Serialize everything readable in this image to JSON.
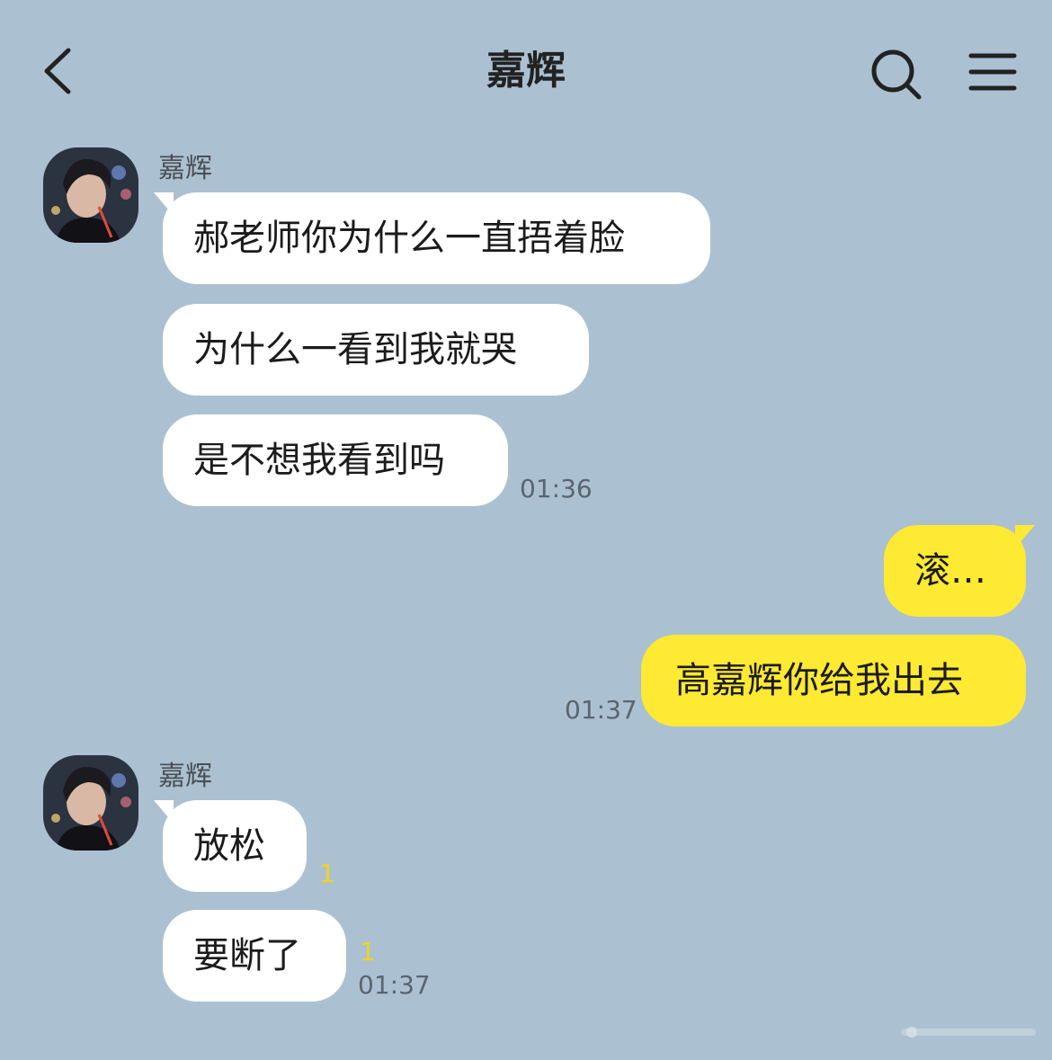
{
  "header": {
    "title": "嘉辉",
    "back_icon": "chevron-left-icon",
    "search_icon": "search-icon",
    "menu_icon": "hamburger-menu-icon"
  },
  "colors": {
    "background": "#abc1d1",
    "incoming_bubble": "#ffffff",
    "outgoing_bubble": "#fee933",
    "unread_count": "#f4d21d"
  },
  "groups": [
    {
      "sender": "嘉辉",
      "messages": [
        {
          "text": "郝老师你为什么一直捂着脸"
        },
        {
          "text": "为什么一看到我就哭"
        },
        {
          "text": "是不想我看到吗",
          "time": "01:36"
        }
      ]
    },
    {
      "outgoing": true,
      "messages": [
        {
          "text": "滚…"
        },
        {
          "text": "高嘉辉你给我出去",
          "time": "01:37"
        }
      ]
    },
    {
      "sender": "嘉辉",
      "messages": [
        {
          "text": "放松",
          "unread": "1"
        },
        {
          "text": "要断了",
          "unread": "1",
          "time": "01:37"
        }
      ]
    }
  ]
}
